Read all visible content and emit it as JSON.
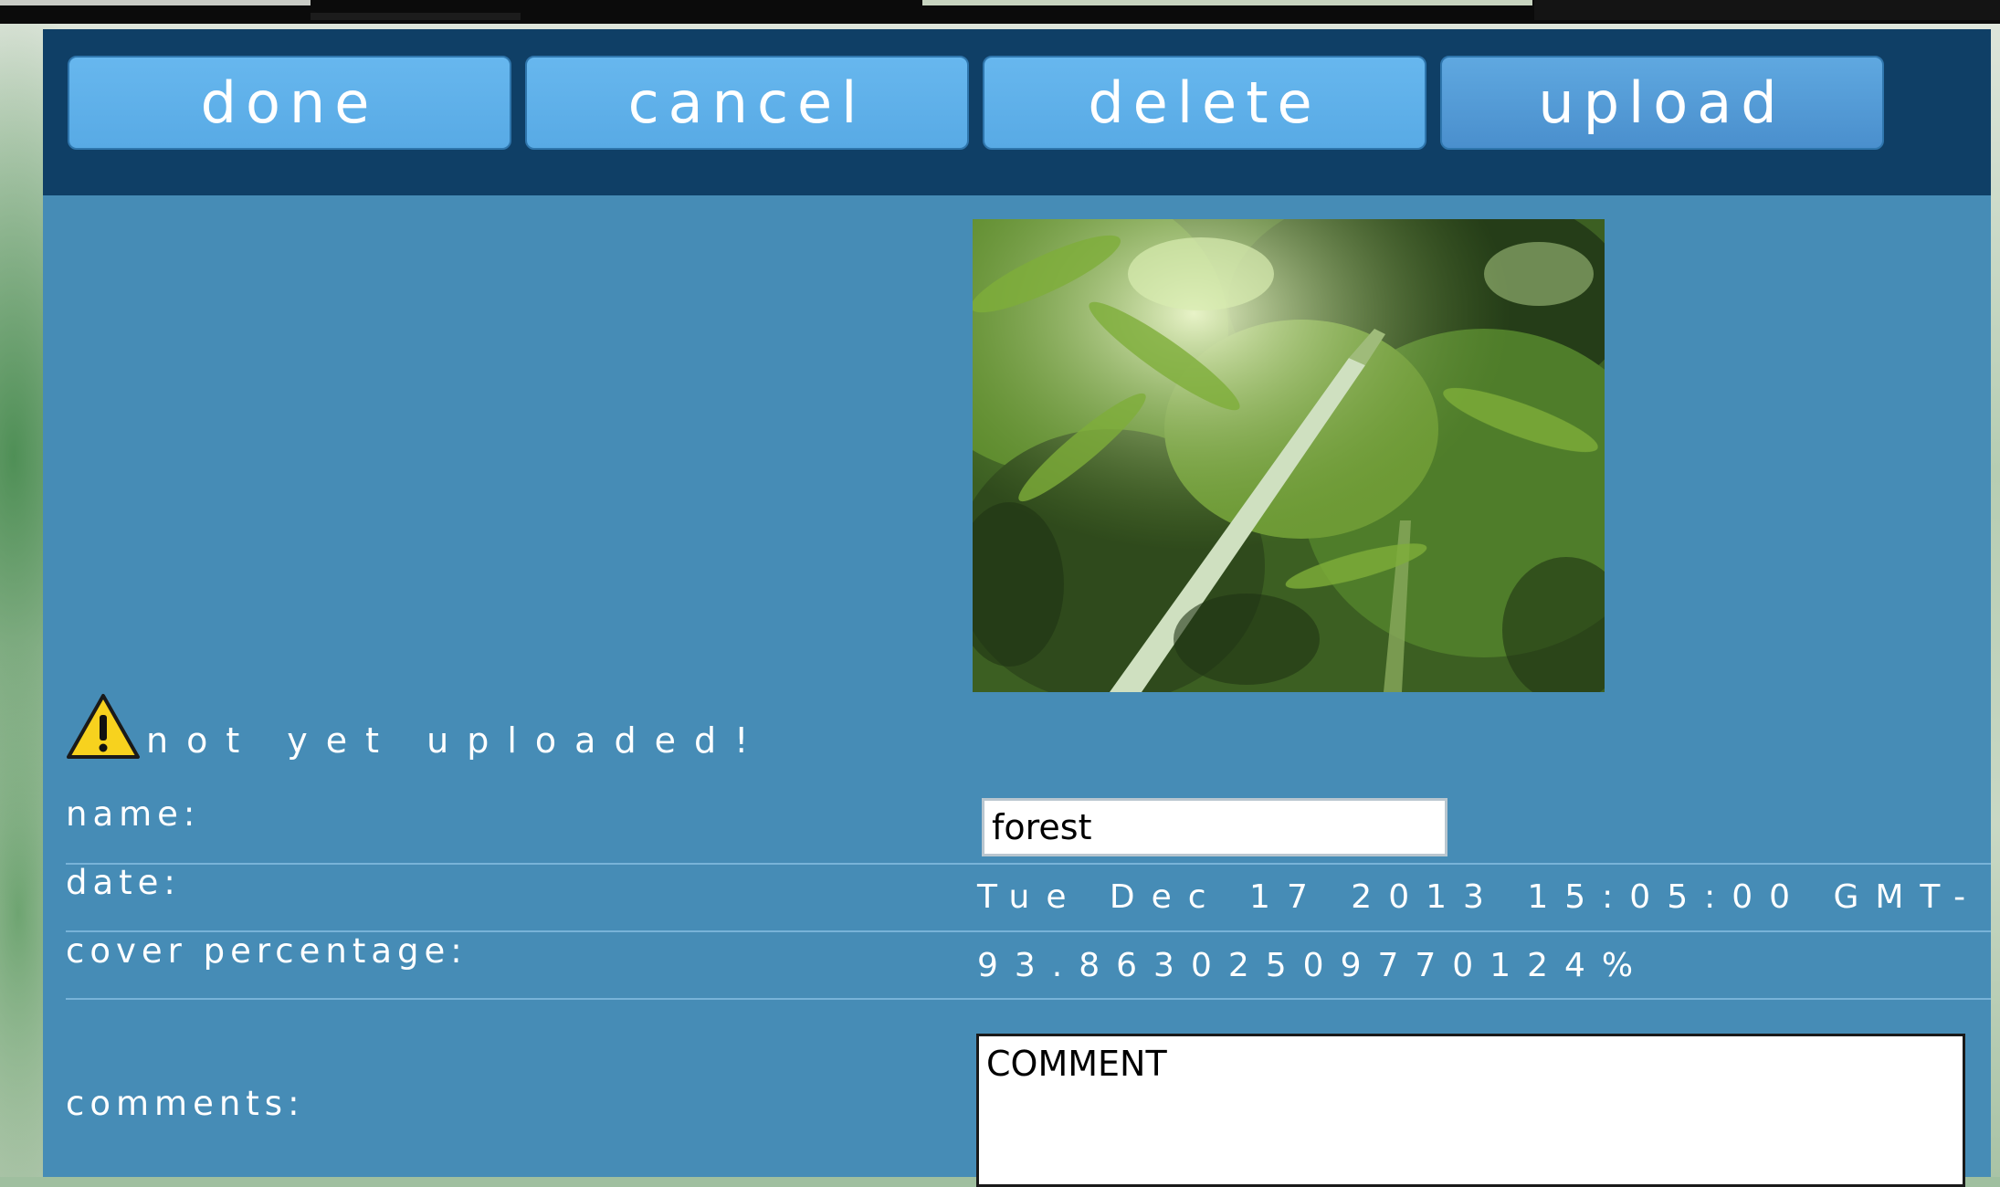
{
  "toolbar": {
    "buttons": [
      {
        "label": "done"
      },
      {
        "label": "cancel"
      },
      {
        "label": "delete"
      },
      {
        "label": "upload"
      }
    ]
  },
  "photo": {
    "subject": "forest canopy"
  },
  "status": {
    "icon": "warning-icon",
    "text": "not yet uploaded!"
  },
  "fields": {
    "name": {
      "label": "name:",
      "value": "forest"
    },
    "date": {
      "label": "date:",
      "value": "Tue Dec 17 2013 15:05:00 GMT-"
    },
    "cover": {
      "label": "cover percentage:",
      "value": "93.86302509770124%"
    },
    "comments": {
      "label": "comments:",
      "value": "COMMENT"
    }
  },
  "colors": {
    "header": "#0f3f66",
    "panel": "#468cb6",
    "button": "#5fb0ea",
    "warning": "#f7d21e"
  }
}
